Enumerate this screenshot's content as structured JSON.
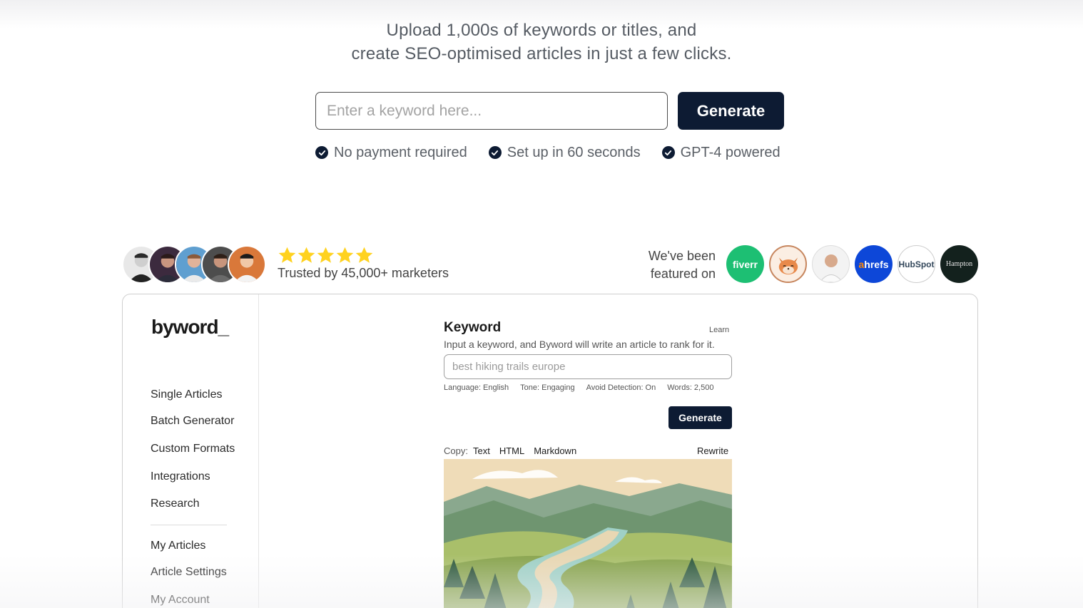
{
  "hero": {
    "subtitle_line1": "Upload 1,000s of keywords or titles, and",
    "subtitle_line2": "create SEO-optimised articles in just a few clicks.",
    "input_placeholder": "Enter a keyword here...",
    "generate_label": "Generate",
    "checks": [
      "No payment required",
      "Set up in 60 seconds",
      "GPT-4 powered"
    ]
  },
  "social_proof": {
    "rating_stars": 5,
    "trusted_text": "Trusted by 45,000+ marketers",
    "featured_line1": "We've been",
    "featured_line2": "featured on",
    "logos": {
      "fiverr": "fiverr",
      "ahrefs_a": "a",
      "ahrefs_rest": "hrefs",
      "hubspot": "HubSpot",
      "hampton": "Hampton"
    }
  },
  "app": {
    "brand": "byword_",
    "nav_primary": [
      "Single Articles",
      "Batch Generator",
      "Custom Formats",
      "Integrations",
      "Research"
    ],
    "nav_secondary": [
      "My Articles",
      "Article Settings",
      "My Account"
    ],
    "keyword_label": "Keyword",
    "learn_label": "Learn",
    "help_text": "Input a keyword, and Byword will write an article to rank for it.",
    "keyword_placeholder": "best hiking trails europe",
    "options": [
      "Language: English",
      "Tone: Engaging",
      "Avoid Detection: On",
      "Words: 2,500"
    ],
    "generate_label": "Generate",
    "copy_label": "Copy:",
    "copy_options": [
      "Text",
      "HTML",
      "Markdown"
    ],
    "rewrite_label": "Rewrite"
  },
  "colors": {
    "navy": "#0d1b33",
    "star": "#ffd21f",
    "fiverr": "#1dbf73",
    "ahrefs": "#0d47d8"
  }
}
